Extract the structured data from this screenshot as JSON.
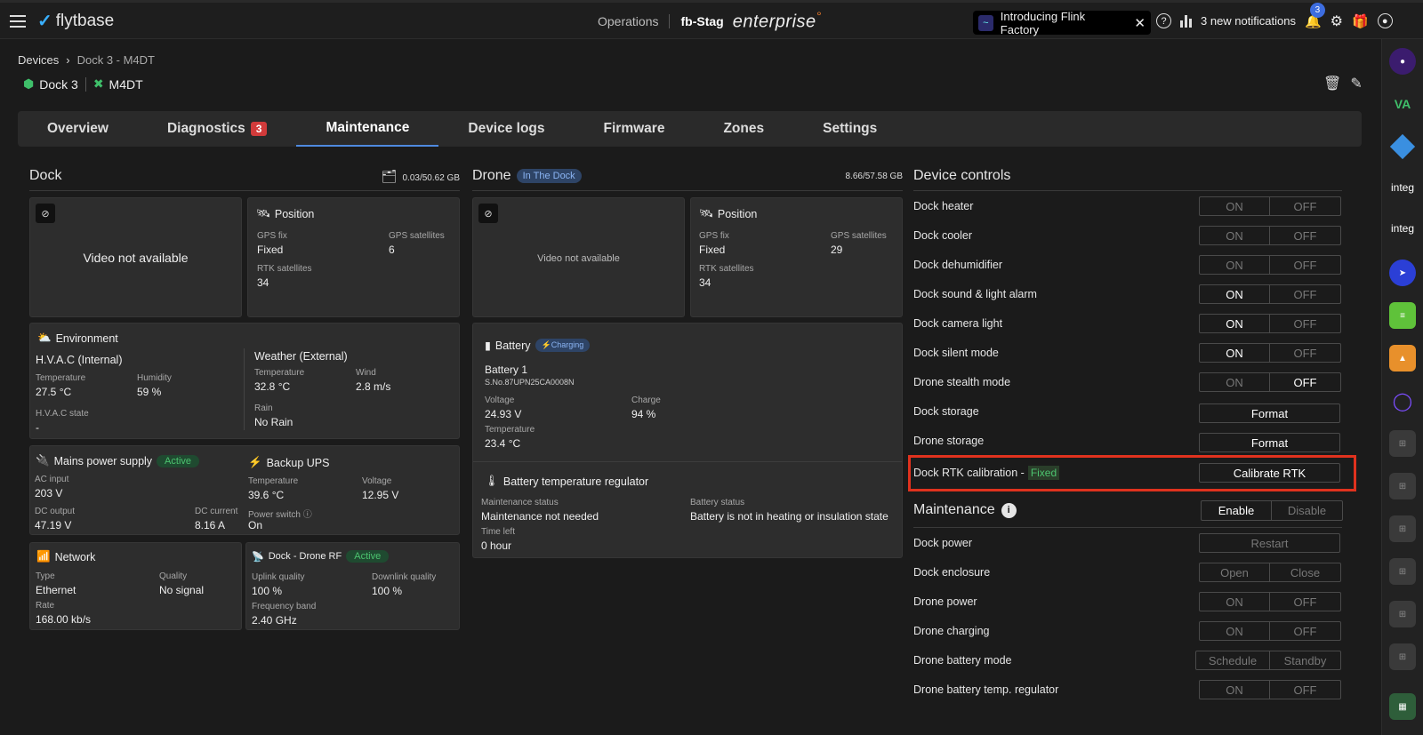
{
  "topbar": {
    "logo_text": "flytbase",
    "operations": "Operations",
    "org": "fb-Stag",
    "enterprise": "enterprise",
    "flink_text": "Introducing Flink Factory",
    "notifications_text": "3 new notifications",
    "bell_count": "3",
    "help_icon": "question-icon",
    "brand_color": "#e8792b"
  },
  "breadcrumb": {
    "root": "Devices",
    "current": "Dock 3 - M4DT"
  },
  "device": {
    "dock_name": "Dock 3",
    "drone_name": "M4DT"
  },
  "tabs": [
    {
      "label": "Overview"
    },
    {
      "label": "Diagnostics",
      "count": "3"
    },
    {
      "label": "Maintenance"
    },
    {
      "label": "Device logs"
    },
    {
      "label": "Firmware"
    },
    {
      "label": "Zones"
    },
    {
      "label": "Settings"
    }
  ],
  "dock": {
    "title": "Dock",
    "storage": "0.03/50.62 GB",
    "video": "Video not available",
    "position": {
      "title": "Position",
      "gps_fix_label": "GPS fix",
      "gps_fix": "Fixed",
      "gps_sat_label": "GPS satellites",
      "gps_sat": "6",
      "rtk_label": "RTK satellites",
      "rtk": "34"
    },
    "environment": {
      "title": "Environment",
      "hvac_title": "H.V.A.C (Internal)",
      "temp_label": "Temperature",
      "temp": "27.5 °C",
      "hum_label": "Humidity",
      "hum": "59 %",
      "hvac_state_label": "H.V.A.C state",
      "hvac_state": "-",
      "weather_title": "Weather (External)",
      "wtemp_label": "Temperature",
      "wtemp": "32.8 °C",
      "wind_label": "Wind",
      "wind": "2.8 m/s",
      "rain_label": "Rain",
      "rain": "No Rain"
    },
    "mains": {
      "title": "Mains power supply",
      "status": "Active",
      "ac_label": "AC input",
      "ac": "203 V",
      "dco_label": "DC output",
      "dco": "47.19 V",
      "dcc_label": "DC current",
      "dcc": "8.16 A"
    },
    "ups": {
      "title": "Backup UPS",
      "temp_label": "Temperature",
      "temp": "39.6 °C",
      "volt_label": "Voltage",
      "volt": "12.95 V",
      "switch_label": "Power switch",
      "switch": "On"
    },
    "network": {
      "title": "Network",
      "type_label": "Type",
      "type": "Ethernet",
      "quality_label": "Quality",
      "quality": "No signal",
      "rate_label": "Rate",
      "rate": "168.00 kb/s"
    },
    "rf": {
      "title": "Dock - Drone RF",
      "status": "Active",
      "up_label": "Uplink quality",
      "up": "100 %",
      "down_label": "Downlink quality",
      "down": "100 %",
      "freq_label": "Frequency band",
      "freq": "2.40 GHz"
    }
  },
  "drone": {
    "title": "Drone",
    "status": "In The Dock",
    "storage": "8.66/57.58 GB",
    "video": "Video not available",
    "position": {
      "title": "Position",
      "gps_fix_label": "GPS fix",
      "gps_fix": "Fixed",
      "gps_sat_label": "GPS satellites",
      "gps_sat": "29",
      "rtk_label": "RTK satellites",
      "rtk": "34"
    },
    "battery": {
      "title": "Battery",
      "status": "Charging",
      "name": "Battery 1",
      "serial": "S.No.87UPN25CA0008N",
      "volt_label": "Voltage",
      "volt": "24.93 V",
      "charge_label": "Charge",
      "charge": "94 %",
      "temp_label": "Temperature",
      "temp": "23.4 °C"
    },
    "regulator": {
      "title": "Battery temperature regulator",
      "ms_label": "Maintenance status",
      "ms": "Maintenance not needed",
      "bs_label": "Battery status",
      "bs": "Battery is not in heating or insulation state",
      "tl_label": "Time left",
      "tl": "0 hour"
    }
  },
  "controls": {
    "title": "Device controls",
    "on": "ON",
    "off": "OFF",
    "format": "Format",
    "items": [
      {
        "name": "Dock heater"
      },
      {
        "name": "Dock cooler"
      },
      {
        "name": "Dock dehumidifier"
      },
      {
        "name": "Dock sound & light alarm"
      },
      {
        "name": "Dock camera light"
      },
      {
        "name": "Dock silent mode"
      },
      {
        "name": "Drone stealth mode"
      },
      {
        "name": "Dock storage"
      },
      {
        "name": "Drone storage"
      }
    ],
    "rtk_label": "Dock RTK calibration -",
    "rtk_status": "Fixed",
    "rtk_button": "Calibrate RTK"
  },
  "maintenance": {
    "title": "Maintenance",
    "enable": "Enable",
    "disable": "Disable",
    "restart": "Restart",
    "open": "Open",
    "close": "Close",
    "schedule": "Schedule",
    "standby": "Standby",
    "items": [
      {
        "name": "Dock power"
      },
      {
        "name": "Dock enclosure"
      },
      {
        "name": "Drone power"
      },
      {
        "name": "Drone charging"
      },
      {
        "name": "Drone battery mode"
      },
      {
        "name": "Drone battery temp. regulator"
      }
    ]
  },
  "rail": {
    "integ_1": "integ",
    "integ_2": "integ"
  }
}
